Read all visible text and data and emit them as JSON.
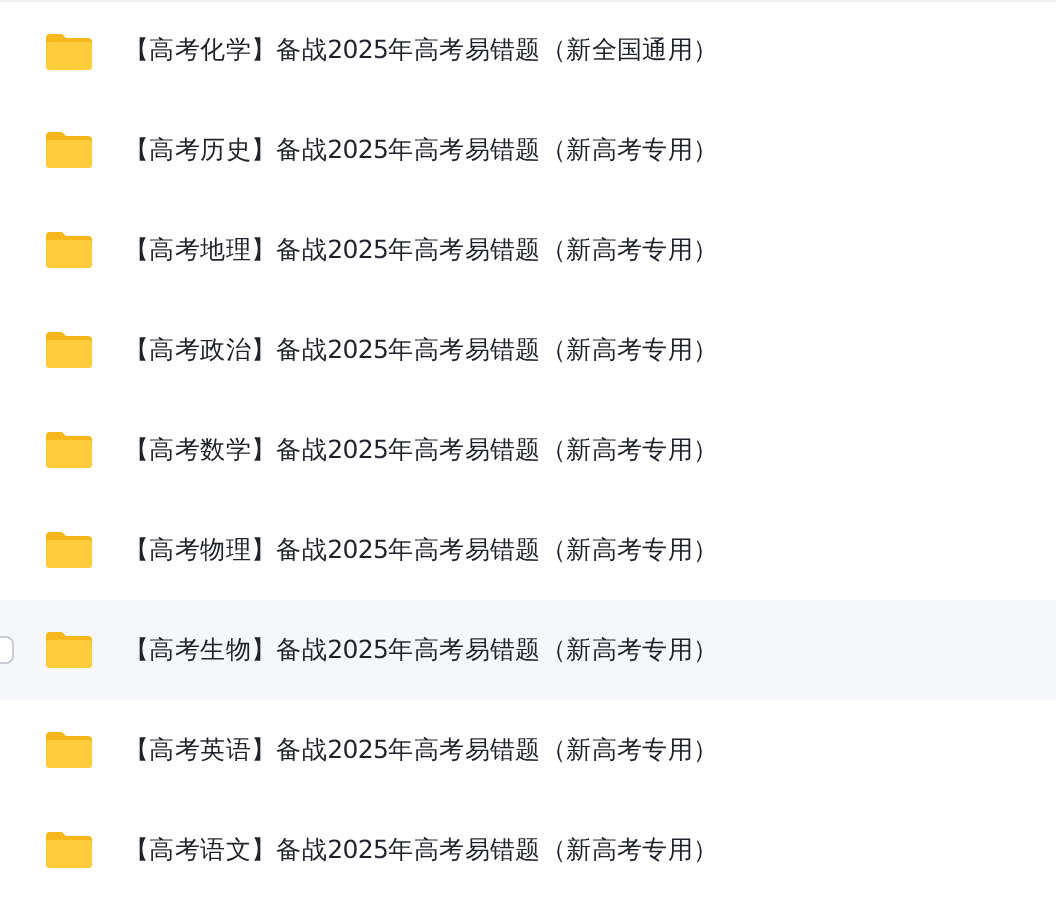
{
  "files": [
    {
      "name": "【高考化学】备战2025年高考易错题（新全国通用）",
      "hovered": false
    },
    {
      "name": "【高考历史】备战2025年高考易错题（新高考专用）",
      "hovered": false
    },
    {
      "name": "【高考地理】备战2025年高考易错题（新高考专用）",
      "hovered": false
    },
    {
      "name": "【高考政治】备战2025年高考易错题（新高考专用）",
      "hovered": false
    },
    {
      "name": "【高考数学】备战2025年高考易错题（新高考专用）",
      "hovered": false
    },
    {
      "name": "【高考物理】备战2025年高考易错题（新高考专用）",
      "hovered": false
    },
    {
      "name": "【高考生物】备战2025年高考易错题（新高考专用）",
      "hovered": true
    },
    {
      "name": "【高考英语】备战2025年高考易错题（新高考专用）",
      "hovered": false
    },
    {
      "name": "【高考语文】备战2025年高考易错题（新高考专用）",
      "hovered": false
    }
  ]
}
